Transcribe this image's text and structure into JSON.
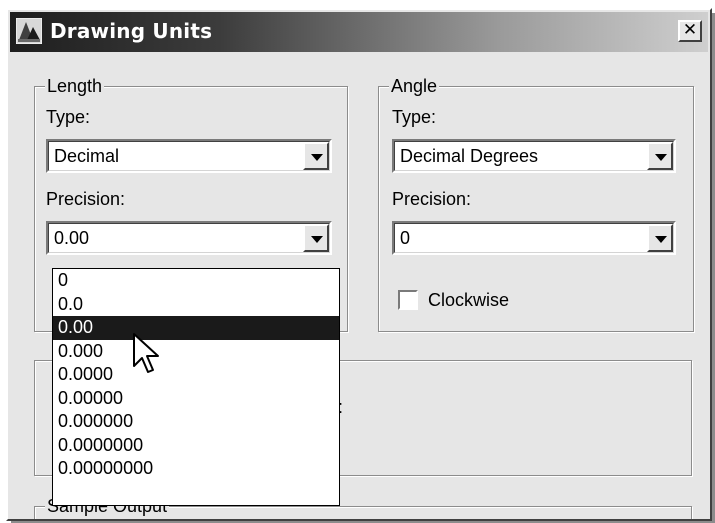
{
  "window": {
    "title": "Drawing Units",
    "close_label": "✕"
  },
  "length": {
    "group_label": "Length",
    "type_label": "Type:",
    "type_value": "Decimal",
    "precision_label": "Precision:",
    "precision_value": "0.00"
  },
  "angle": {
    "group_label": "Angle",
    "type_label": "Type:",
    "type_value": "Decimal Degrees",
    "precision_label": "Precision:",
    "precision_value": "0",
    "clockwise_label": "Clockwise",
    "clockwise_checked": false
  },
  "precision_dropdown": {
    "options": [
      "0",
      "0.0",
      "0.00",
      "0.000",
      "0.0000",
      "0.00000",
      "0.000000",
      "0.0000000",
      "0.00000000"
    ],
    "selected": "0.00"
  },
  "insertion_group": {
    "partial_text": ":"
  },
  "sample_output": {
    "group_label": "Sample Output"
  },
  "icons": {
    "app": "drawing-units-app-icon",
    "dropdown_arrow": "chevron-down-icon",
    "cursor": "mouse-pointer-icon"
  }
}
